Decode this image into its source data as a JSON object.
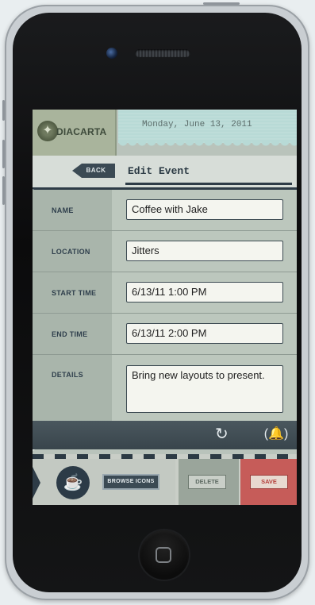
{
  "app": {
    "logo_text": "DIACARTA",
    "date": "Monday, June 13, 2011"
  },
  "nav": {
    "back_label": "BACK",
    "title": "Edit Event"
  },
  "form": {
    "fields": [
      {
        "label": "NAME",
        "value": "Coffee with Jake"
      },
      {
        "label": "LOCATION",
        "value": "Jitters"
      },
      {
        "label": "START TIME",
        "value": "6/13/11 1:00 PM"
      },
      {
        "label": "END TIME",
        "value": "6/13/11 2:00 PM"
      },
      {
        "label": "DETAILS",
        "value": "Bring new layouts to present."
      }
    ]
  },
  "toolbar": {
    "icons": [
      "refresh-icon",
      "alarm-bell-icon"
    ]
  },
  "bottom": {
    "browse_label": "BROWSE ICONS",
    "delete_label": "DELETE",
    "save_label": "SAVE",
    "selected_icon": "coffee-mug-icon"
  },
  "colors": {
    "accent_dark": "#2e3c47",
    "date_strip": "#b8dad6",
    "save_red": "#c65c59",
    "delete_green": "#9aa59b"
  }
}
